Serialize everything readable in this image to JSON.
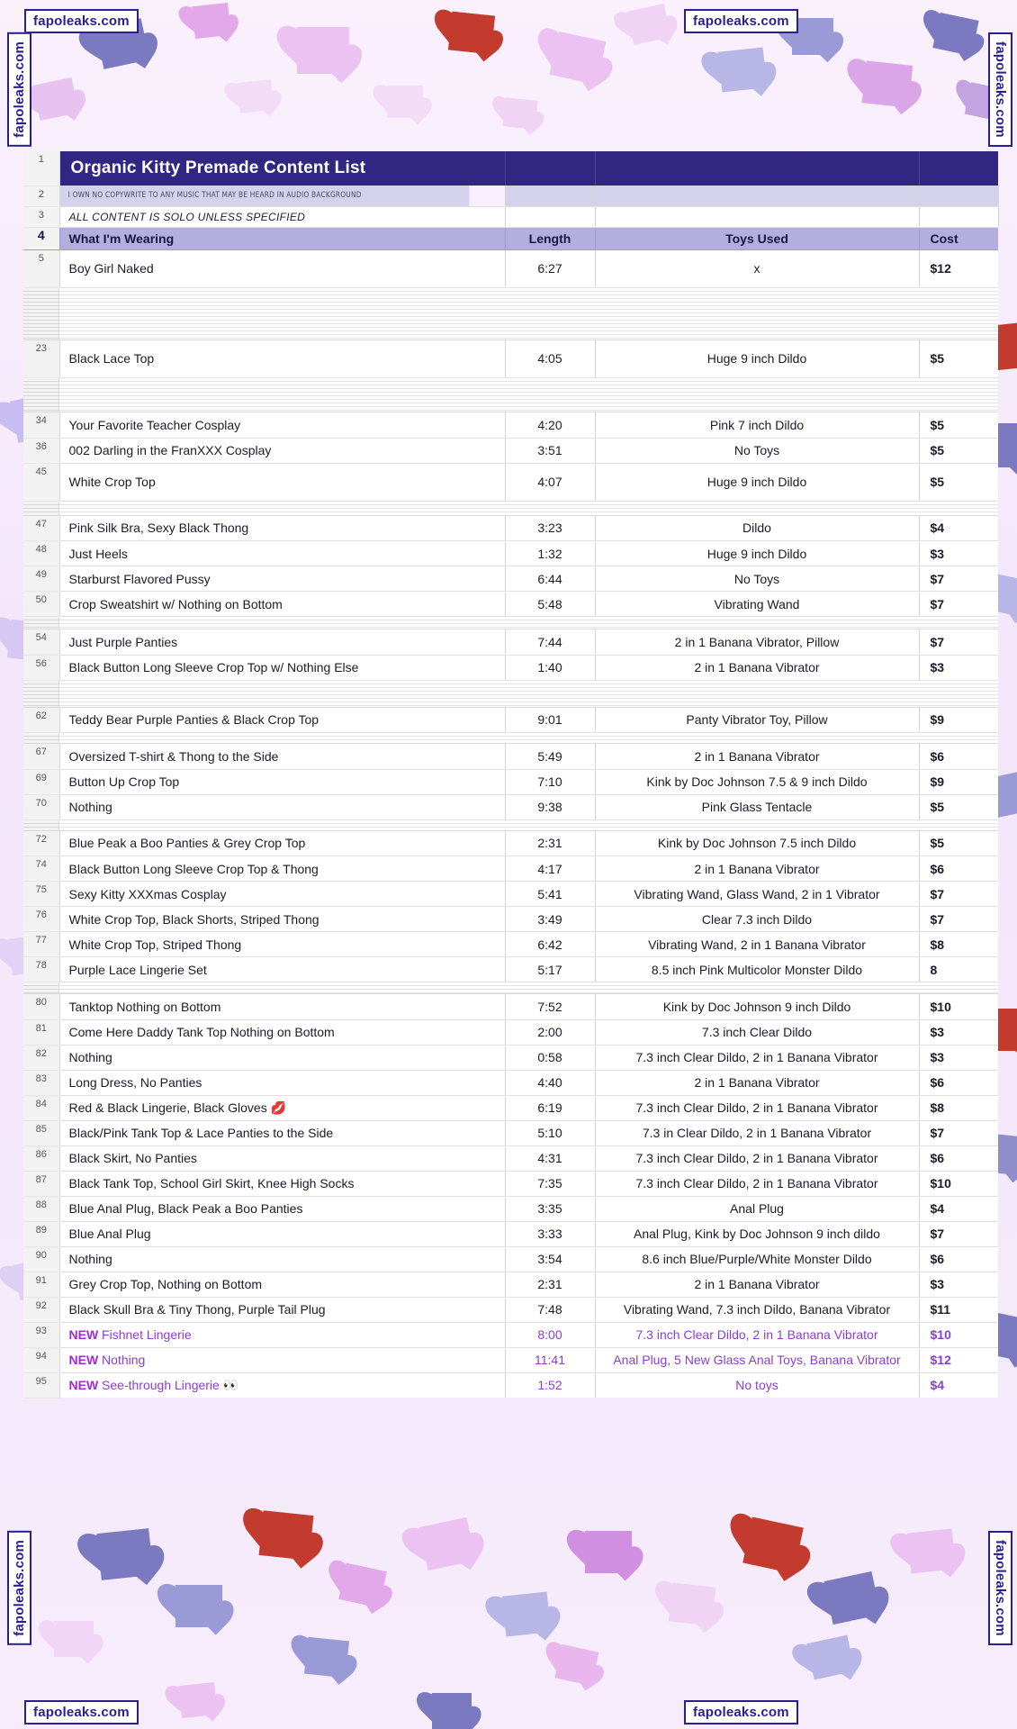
{
  "document": {
    "title": "Organic Kitty Premade Content List",
    "note_copyright": "I OWN NO COPYWRITE TO ANY MUSIC THAT MAY BE HEARD IN AUDIO BACKGROUND",
    "note_solo": "ALL CONTENT IS SOLO UNLESS SPECIFIED",
    "title_bar_color": "#312783",
    "header_row_color": "#b3aedb",
    "note_row_color": "#d3d1ec",
    "new_row_color": "#8b3fc7"
  },
  "columns": {
    "wearing": "What I'm Wearing",
    "length": "Length",
    "toys": "Toys Used",
    "cost": "Cost"
  },
  "row_numbers": {
    "title": "1",
    "note_copyright": "2",
    "note_solo": "3",
    "header": "4"
  },
  "rows": [
    {
      "num": "5",
      "wearing": "Boy Girl Naked",
      "length": "6:27",
      "toys": "x",
      "cost": "$12",
      "size": "tall",
      "new": false
    },
    {
      "num": "23",
      "wearing": "Black Lace Top",
      "length": "4:05",
      "toys": "Huge 9 inch Dildo",
      "cost": "$5",
      "size": "tall",
      "new": false
    },
    {
      "num": "34",
      "wearing": "Your Favorite Teacher Cosplay",
      "length": "4:20",
      "toys": "Pink 7 inch Dildo",
      "cost": "$5",
      "size": "normal",
      "new": false
    },
    {
      "num": "36",
      "wearing": "002 Darling in the FranXXX Cosplay",
      "length": "3:51",
      "toys": "No Toys",
      "cost": "$5",
      "size": "normal",
      "new": false
    },
    {
      "num": "45",
      "wearing": "White Crop Top",
      "length": "4:07",
      "toys": "Huge 9 inch Dildo",
      "cost": "$5",
      "size": "tall",
      "new": false
    },
    {
      "num": "47",
      "wearing": "Pink Silk Bra, Sexy Black Thong",
      "length": "3:23",
      "toys": "Dildo",
      "cost": "$4",
      "size": "normal",
      "new": false
    },
    {
      "num": "48",
      "wearing": "Just Heels",
      "length": "1:32",
      "toys": "Huge 9 inch Dildo",
      "cost": "$3",
      "size": "normal",
      "new": false
    },
    {
      "num": "49",
      "wearing": "Starburst Flavored Pussy",
      "length": "6:44",
      "toys": "No Toys",
      "cost": "$7",
      "size": "normal",
      "new": false
    },
    {
      "num": "50",
      "wearing": "Crop Sweatshirt w/ Nothing on Bottom",
      "length": "5:48",
      "toys": "Vibrating Wand",
      "cost": "$7",
      "size": "normal",
      "new": false
    },
    {
      "num": "54",
      "wearing": "Just Purple Panties",
      "length": "7:44",
      "toys": "2 in 1 Banana Vibrator, Pillow",
      "cost": "$7",
      "size": "normal",
      "new": false
    },
    {
      "num": "56",
      "wearing": "Black Button Long Sleeve Crop Top w/ Nothing Else",
      "length": "1:40",
      "toys": "2 in 1 Banana Vibrator",
      "cost": "$3",
      "size": "normal",
      "new": false
    },
    {
      "num": "62",
      "wearing": "Teddy Bear Purple Panties & Black Crop Top",
      "length": "9:01",
      "toys": "Panty Vibrator Toy, Pillow",
      "cost": "$9",
      "size": "normal",
      "new": false
    },
    {
      "num": "67",
      "wearing": "Oversized T-shirt & Thong to the Side",
      "length": "5:49",
      "toys": "2 in 1 Banana Vibrator",
      "cost": "$6",
      "size": "normal",
      "new": false
    },
    {
      "num": "69",
      "wearing": "Button Up Crop Top",
      "length": "7:10",
      "toys": "Kink by Doc Johnson 7.5 & 9 inch Dildo",
      "cost": "$9",
      "size": "normal",
      "new": false
    },
    {
      "num": "70",
      "wearing": "Nothing",
      "length": "9:38",
      "toys": "Pink Glass Tentacle",
      "cost": "$5",
      "size": "normal",
      "new": false
    },
    {
      "num": "72",
      "wearing": "Blue Peak a Boo Panties & Grey Crop Top",
      "length": "2:31",
      "toys": "Kink by Doc Johnson 7.5 inch Dildo",
      "cost": "$5",
      "size": "normal",
      "new": false
    },
    {
      "num": "74",
      "wearing": "Black Button Long Sleeve Crop Top & Thong",
      "length": "4:17",
      "toys": "2 in 1 Banana Vibrator",
      "cost": "$6",
      "size": "normal",
      "new": false
    },
    {
      "num": "75",
      "wearing": "Sexy Kitty XXXmas Cosplay",
      "length": "5:41",
      "toys": "Vibrating Wand, Glass Wand, 2 in 1 Vibrator",
      "cost": "$7",
      "size": "normal",
      "new": false
    },
    {
      "num": "76",
      "wearing": "White Crop Top, Black Shorts, Striped Thong",
      "length": "3:49",
      "toys": "Clear 7.3 inch Dildo",
      "cost": "$7",
      "size": "normal",
      "new": false
    },
    {
      "num": "77",
      "wearing": "White Crop Top, Striped Thong",
      "length": "6:42",
      "toys": "Vibrating Wand, 2 in 1 Banana Vibrator",
      "cost": "$8",
      "size": "normal",
      "new": false
    },
    {
      "num": "78",
      "wearing": "Purple Lace Lingerie Set",
      "length": "5:17",
      "toys": "8.5 inch Pink Multicolor Monster Dildo",
      "cost": "8",
      "size": "normal",
      "new": false
    },
    {
      "num": "80",
      "wearing": "Tanktop Nothing on Bottom",
      "length": "7:52",
      "toys": "Kink by Doc Johnson 9 inch Dildo",
      "cost": "$10",
      "size": "normal",
      "new": false
    },
    {
      "num": "81",
      "wearing": "Come Here Daddy Tank Top Nothing on Bottom",
      "length": "2:00",
      "toys": "7.3 inch Clear Dildo",
      "cost": "$3",
      "size": "normal",
      "new": false
    },
    {
      "num": "82",
      "wearing": "Nothing",
      "length": "0:58",
      "toys": "7.3 inch Clear Dildo, 2 in 1 Banana Vibrator",
      "cost": "$3",
      "size": "normal",
      "new": false
    },
    {
      "num": "83",
      "wearing": "Long Dress, No Panties",
      "length": "4:40",
      "toys": "2 in 1 Banana Vibrator",
      "cost": "$6",
      "size": "normal",
      "new": false
    },
    {
      "num": "84",
      "wearing": "Red & Black Lingerie, Black Gloves 💋",
      "length": "6:19",
      "toys": "7.3 inch Clear Dildo, 2 in 1 Banana Vibrator",
      "cost": "$8",
      "size": "normal",
      "new": false
    },
    {
      "num": "85",
      "wearing": "Black/Pink Tank Top & Lace Panties to the Side",
      "length": "5:10",
      "toys": "7.3 in Clear Dildo, 2 in 1 Banana Vibrator",
      "cost": "$7",
      "size": "normal",
      "new": false
    },
    {
      "num": "86",
      "wearing": "Black Skirt, No Panties",
      "length": "4:31",
      "toys": "7.3 inch Clear Dildo, 2 in 1 Banana Vibrator",
      "cost": "$6",
      "size": "normal",
      "new": false
    },
    {
      "num": "87",
      "wearing": "Black Tank Top, School Girl Skirt, Knee High Socks",
      "length": "7:35",
      "toys": "7.3 inch Clear Dildo, 2 in 1 Banana Vibrator",
      "cost": "$10",
      "size": "normal",
      "new": false
    },
    {
      "num": "88",
      "wearing": "Blue Anal Plug, Black Peak a Boo Panties",
      "length": "3:35",
      "toys": "Anal Plug",
      "cost": "$4",
      "size": "normal",
      "new": false
    },
    {
      "num": "89",
      "wearing": "Blue Anal Plug",
      "length": "3:33",
      "toys": "Anal Plug, Kink by Doc Johnson 9 inch dildo",
      "cost": "$7",
      "size": "normal",
      "new": false
    },
    {
      "num": "90",
      "wearing": "Nothing",
      "length": "3:54",
      "toys": "8.6 inch Blue/Purple/White Monster Dildo",
      "cost": "$6",
      "size": "normal",
      "new": false
    },
    {
      "num": "91",
      "wearing": "Grey Crop Top, Nothing on Bottom",
      "length": "2:31",
      "toys": "2 in 1 Banana Vibrator",
      "cost": "$3",
      "size": "normal",
      "new": false
    },
    {
      "num": "92",
      "wearing": "Black Skull Bra & Tiny Thong, Purple Tail Plug",
      "length": "7:48",
      "toys": "Vibrating Wand, 7.3 inch Dildo, Banana Vibrator",
      "cost": "$11",
      "size": "normal",
      "new": false
    },
    {
      "num": "93",
      "wearing": "Fishnet Lingerie",
      "new_tag": "NEW",
      "length": "8:00",
      "toys": "7.3 inch Clear Dildo, 2 in 1 Banana Vibrator",
      "cost": "$10",
      "size": "normal",
      "new": true
    },
    {
      "num": "94",
      "wearing": "Nothing",
      "new_tag": "NEW",
      "length": "11:41",
      "toys": "Anal Plug, 5 New Glass Anal Toys, Banana Vibrator",
      "cost": "$12",
      "size": "normal",
      "new": true
    },
    {
      "num": "95",
      "wearing": "See-through Lingerie 👀",
      "new_tag": "NEW",
      "length": "1:52",
      "toys": "No toys",
      "cost": "$4",
      "size": "normal",
      "new": true
    }
  ],
  "collapsed_gaps": {
    "after_5": true,
    "after_23": true,
    "after_45": true,
    "after_50": true,
    "after_56": true,
    "after_62": true,
    "after_70": true,
    "after_78": true
  },
  "watermarks": {
    "text": "fapoleaks.com",
    "positions": [
      "top-left",
      "top-right",
      "left-upper",
      "right-upper",
      "bottom-left",
      "bottom-right",
      "left-lower",
      "right-lower"
    ]
  }
}
